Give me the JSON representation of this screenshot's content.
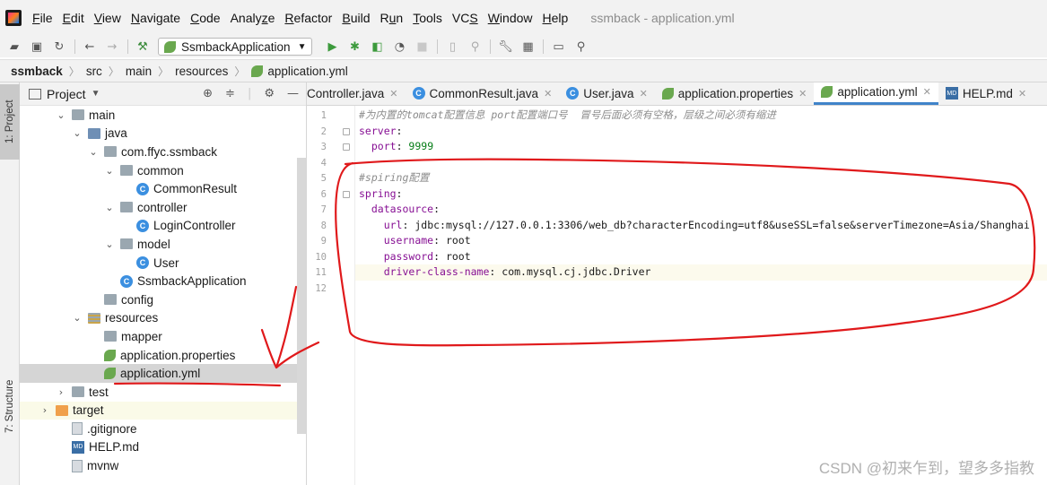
{
  "menubar": {
    "items": [
      {
        "label": "File",
        "u": "F"
      },
      {
        "label": "Edit",
        "u": "E"
      },
      {
        "label": "View",
        "u": "V"
      },
      {
        "label": "Navigate",
        "u": "N"
      },
      {
        "label": "Code",
        "u": "C"
      },
      {
        "label": "Analyze",
        "u": "z"
      },
      {
        "label": "Refactor",
        "u": "R"
      },
      {
        "label": "Build",
        "u": "B"
      },
      {
        "label": "Run",
        "u": "u"
      },
      {
        "label": "Tools",
        "u": "T"
      },
      {
        "label": "VCS",
        "u": "S"
      },
      {
        "label": "Window",
        "u": "W"
      },
      {
        "label": "Help",
        "u": "H"
      }
    ],
    "window_title": "ssmback - application.yml"
  },
  "toolbar": {
    "run_config": "SsmbackApplication"
  },
  "breadcrumb": [
    "ssmback",
    "src",
    "main",
    "resources",
    "application.yml"
  ],
  "left_stripe": {
    "project_tab": "1: Project",
    "structure_tab": "7: Structure"
  },
  "project_panel": {
    "title": "Project",
    "tree": [
      {
        "label": "main",
        "depth": 2,
        "chev": "down",
        "icon": "folder"
      },
      {
        "label": "java",
        "depth": 3,
        "chev": "down",
        "icon": "folder-src"
      },
      {
        "label": "com.ffyc.ssmback",
        "depth": 4,
        "chev": "down",
        "icon": "folder-pkg"
      },
      {
        "label": "common",
        "depth": 5,
        "chev": "down",
        "icon": "folder-pkg"
      },
      {
        "label": "CommonResult",
        "depth": 6,
        "chev": "none",
        "icon": "class"
      },
      {
        "label": "controller",
        "depth": 5,
        "chev": "down",
        "icon": "folder-pkg"
      },
      {
        "label": "LoginController",
        "depth": 6,
        "chev": "none",
        "icon": "class"
      },
      {
        "label": "model",
        "depth": 5,
        "chev": "down",
        "icon": "folder-pkg"
      },
      {
        "label": "User",
        "depth": 6,
        "chev": "none",
        "icon": "class"
      },
      {
        "label": "SsmbackApplication",
        "depth": 5,
        "chev": "none",
        "icon": "class"
      },
      {
        "label": "config",
        "depth": 4,
        "chev": "none",
        "icon": "folder-pkg"
      },
      {
        "label": "resources",
        "depth": 3,
        "chev": "down",
        "icon": "folder-res"
      },
      {
        "label": "mapper",
        "depth": 4,
        "chev": "none",
        "icon": "folder"
      },
      {
        "label": "application.properties",
        "depth": 4,
        "chev": "none",
        "icon": "leaf"
      },
      {
        "label": "application.yml",
        "depth": 4,
        "chev": "none",
        "icon": "leaf",
        "selected": true
      },
      {
        "label": "test",
        "depth": 2,
        "chev": "right",
        "icon": "folder"
      },
      {
        "label": "target",
        "depth": 1,
        "chev": "right",
        "icon": "folder-orange",
        "hover": true
      },
      {
        "label": ".gitignore",
        "depth": 2,
        "chev": "none",
        "icon": "file"
      },
      {
        "label": "HELP.md",
        "depth": 2,
        "chev": "none",
        "icon": "md"
      },
      {
        "label": "mvnw",
        "depth": 2,
        "chev": "none",
        "icon": "file"
      }
    ]
  },
  "editor": {
    "tabs": [
      {
        "label": "Controller.java",
        "icon": "none"
      },
      {
        "label": "CommonResult.java",
        "icon": "class"
      },
      {
        "label": "User.java",
        "icon": "class"
      },
      {
        "label": "application.properties",
        "icon": "leaf"
      },
      {
        "label": "application.yml",
        "icon": "leaf",
        "active": true
      },
      {
        "label": "HELP.md",
        "icon": "md"
      }
    ],
    "line_numbers": [
      "1",
      "2",
      "3",
      "4",
      "5",
      "6",
      "7",
      "8",
      "9",
      "10",
      "11",
      "12"
    ],
    "lines": [
      [
        {
          "t": "#为内置的tomcat配置信息 port配置端口号  冒号后面必须有空格，层级之间必须有缩进",
          "c": "cmt"
        }
      ],
      [
        {
          "t": "server",
          "c": "key"
        },
        {
          "t": ":",
          "c": "plain"
        }
      ],
      [
        {
          "t": "  ",
          "c": "plain"
        },
        {
          "t": "port",
          "c": "key"
        },
        {
          "t": ": ",
          "c": "plain"
        },
        {
          "t": "9999",
          "c": "val"
        }
      ],
      [
        {
          "t": "",
          "c": "plain"
        }
      ],
      [
        {
          "t": "#spiring配置",
          "c": "cmt"
        }
      ],
      [
        {
          "t": "spring",
          "c": "key"
        },
        {
          "t": ":",
          "c": "plain"
        }
      ],
      [
        {
          "t": "  ",
          "c": "plain"
        },
        {
          "t": "datasource",
          "c": "key"
        },
        {
          "t": ":",
          "c": "plain"
        }
      ],
      [
        {
          "t": "    ",
          "c": "plain"
        },
        {
          "t": "url",
          "c": "key"
        },
        {
          "t": ": ",
          "c": "plain"
        },
        {
          "t": "jdbc:mysql://127.0.0.1:3306/web_db?characterEncoding=utf8&useSSL=false&serverTimezone=Asia/Shanghai",
          "c": "plain"
        }
      ],
      [
        {
          "t": "    ",
          "c": "plain"
        },
        {
          "t": "username",
          "c": "key"
        },
        {
          "t": ": ",
          "c": "plain"
        },
        {
          "t": "root",
          "c": "plain"
        }
      ],
      [
        {
          "t": "    ",
          "c": "plain"
        },
        {
          "t": "password",
          "c": "key"
        },
        {
          "t": ": ",
          "c": "plain"
        },
        {
          "t": "root",
          "c": "plain"
        }
      ],
      [
        {
          "t": "    ",
          "c": "plain"
        },
        {
          "t": "driver-class-name",
          "c": "key"
        },
        {
          "t": ": ",
          "c": "plain"
        },
        {
          "t": "com.mysql.cj.jdbc.Driver",
          "c": "plain"
        }
      ],
      [
        {
          "t": "",
          "c": "plain"
        }
      ]
    ],
    "current_line": 11
  },
  "watermark": "CSDN @初来乍到，望多多指教",
  "colors": {
    "annotation": "#e0191b",
    "accent": "#4083c9",
    "yaml_key": "#871094",
    "yaml_value": "#067d17"
  }
}
